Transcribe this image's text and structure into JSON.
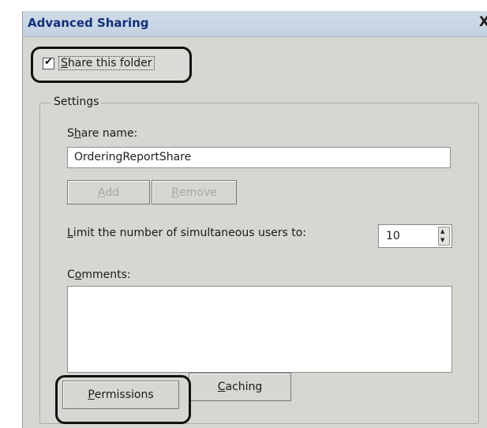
{
  "window": {
    "title": "Advanced Sharing",
    "close_glyph": "X"
  },
  "share": {
    "checked": true,
    "check_glyph": "✔",
    "label_underlined": "S",
    "label_rest": "hare this folder"
  },
  "settings": {
    "legend": "Settings",
    "share_name_label_a": "S",
    "share_name_label_u": "h",
    "share_name_label_b": "are name:",
    "share_name_value": "OrderingReportShare",
    "add_button_u": "A",
    "add_button_rest": "dd",
    "remove_button_u": "R",
    "remove_button_rest": "emove",
    "limit_label_u": "L",
    "limit_label_rest": "imit the number of simultaneous users to:",
    "limit_value": "10",
    "comments_label_a": "C",
    "comments_label_u": "o",
    "comments_label_b": "mments:",
    "permissions_u": "P",
    "permissions_rest": "ermissions",
    "caching_u": "C",
    "caching_rest": "aching"
  },
  "icons": {
    "spin_up": "up-arrow-icon",
    "spin_down": "down-arrow-icon"
  }
}
